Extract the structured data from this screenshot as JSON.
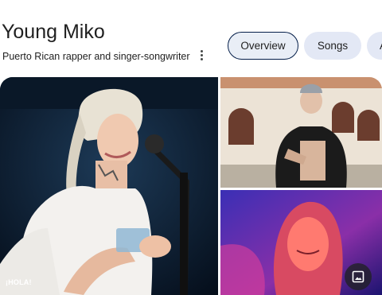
{
  "header": {
    "title": "Young Miko",
    "subtitle": "Puerto Rican rapper and singer-songwriter",
    "more_icon": "more-vert-icon"
  },
  "tabs": [
    {
      "label": "Overview",
      "selected": true
    },
    {
      "label": "Songs",
      "selected": false
    },
    {
      "label": "A",
      "selected": false
    }
  ],
  "images": {
    "main_credit": "¡HOLA!",
    "view_images_icon": "image-icon"
  },
  "colors": {
    "tab_selected_bg": "#e9eef6",
    "tab_selected_border": "#041e49",
    "tab_bg": "#e3e8f5",
    "text": "#1f1f1f"
  }
}
